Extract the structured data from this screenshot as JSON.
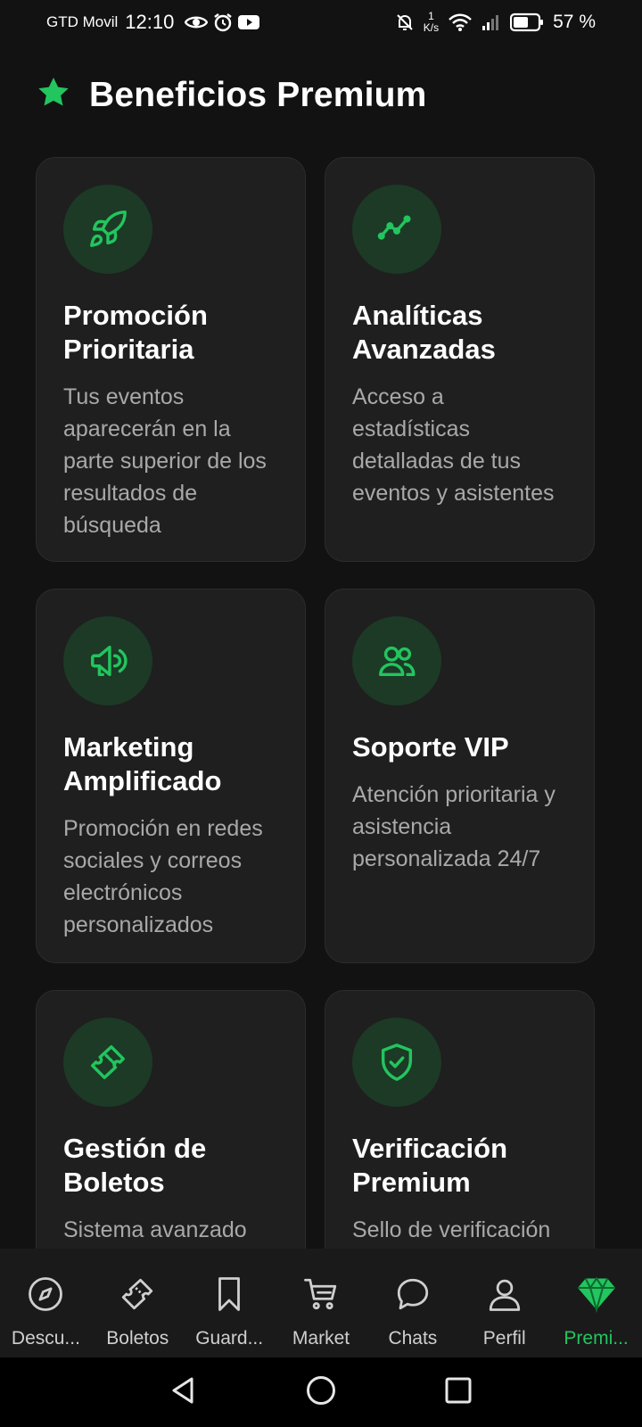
{
  "status_bar": {
    "carrier": "GTD Movil",
    "time": "12:10",
    "net_speed_value": "1",
    "net_speed_unit": "K/s",
    "battery": "57 %"
  },
  "header": {
    "title": "Beneficios Premium",
    "icon": "star-icon"
  },
  "accent_color": "#22c55e",
  "cards": [
    {
      "icon": "rocket-icon",
      "title": "Promoción Prioritaria",
      "description": "Tus eventos aparecerán en la parte superior de los resultados de búsqueda"
    },
    {
      "icon": "trending-up-icon",
      "title": "Analíticas Avanzadas",
      "description": "Acceso a estadísticas detalladas de tus eventos y asistentes"
    },
    {
      "icon": "megaphone-icon",
      "title": "Marketing Amplificado",
      "description": "Promoción en redes sociales y correos electrónicos personalizados"
    },
    {
      "icon": "users-icon",
      "title": "Soporte VIP",
      "description": "Atención prioritaria y asistencia personalizada 24/7"
    },
    {
      "icon": "ticket-icon",
      "title": "Gestión de Boletos",
      "description": "Sistema avanzado"
    },
    {
      "icon": "shield-check-icon",
      "title": "Verificación Premium",
      "description": "Sello de verificación"
    }
  ],
  "bottom_nav": [
    {
      "icon": "compass-icon",
      "label": "Descu..."
    },
    {
      "icon": "ticket-icon",
      "label": "Boletos"
    },
    {
      "icon": "bookmark-icon",
      "label": "Guard..."
    },
    {
      "icon": "cart-icon",
      "label": "Market"
    },
    {
      "icon": "chat-icon",
      "label": "Chats"
    },
    {
      "icon": "user-icon",
      "label": "Perfil"
    },
    {
      "icon": "diamond-icon",
      "label": "Premi...",
      "active": true
    }
  ]
}
